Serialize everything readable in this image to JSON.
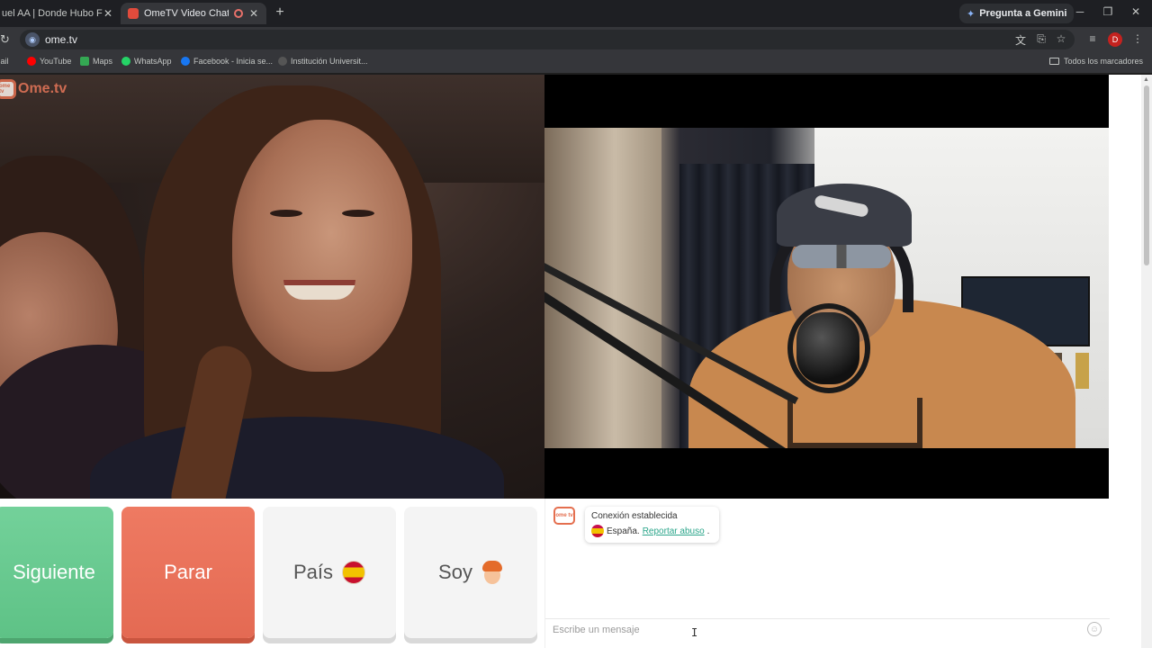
{
  "browser": {
    "tabs": [
      {
        "title": "uel AA | Donde Hubo Fuego",
        "active": false
      },
      {
        "title": "OmeTV Video Chat — Ome",
        "active": true
      }
    ],
    "gemini_label": "Pregunta a Gemini",
    "url": "ome.tv",
    "profile_initial": "D",
    "bookmarks": [
      {
        "label": "Gmail",
        "color": "#ea4335"
      },
      {
        "label": "YouTube",
        "color": "#ff0000"
      },
      {
        "label": "Maps",
        "color": "#34a853"
      },
      {
        "label": "WhatsApp",
        "color": "#25d366"
      },
      {
        "label": "Facebook - Inicia se...",
        "color": "#1877f2"
      },
      {
        "label": "Institución Universit...",
        "color": "#555555"
      }
    ],
    "all_bookmarks_label": "Todos los marcadores"
  },
  "page": {
    "logo_text": "Ome.tv",
    "logo_badge": "ome tv",
    "buttons": {
      "next": "Siguiente",
      "stop": "Parar",
      "country": "País",
      "me": "Soy"
    },
    "chat": {
      "connection": "Conexión establecida",
      "country": "España.",
      "report": "Reportar abuso",
      "report_suffix": ".",
      "placeholder": "Escribe un mensaje"
    },
    "colors": {
      "next": "#5ec286",
      "stop": "#e46a53",
      "accent": "#2aa58a"
    }
  }
}
